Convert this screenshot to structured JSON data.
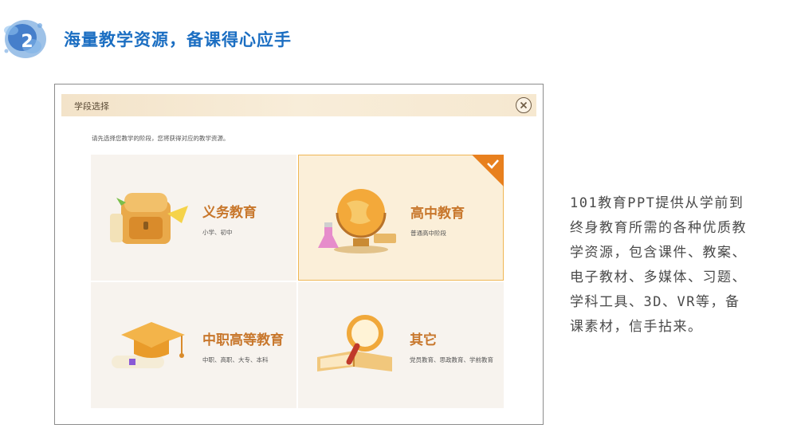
{
  "slide": {
    "number": "2",
    "title": "海量教学资源，备课得心应手"
  },
  "dialog": {
    "title": "学段选择",
    "description": "请先选择您教学的阶段，您将获得对应的教学资源。",
    "cards": [
      {
        "title": "义务教育",
        "subtitle": "小学、初中",
        "selected": false,
        "icon": "schoolbag-icon"
      },
      {
        "title": "高中教育",
        "subtitle": "普通高中阶段",
        "selected": true,
        "icon": "globe-flask-icon"
      },
      {
        "title": "中职高等教育",
        "subtitle": "中职、高职、大专、本科",
        "selected": false,
        "icon": "graduation-cap-icon"
      },
      {
        "title": "其它",
        "subtitle": "党员教育、思政教育、学前教育",
        "selected": false,
        "icon": "magnifier-book-icon"
      }
    ]
  },
  "side_text": "101教育PPT提供从学前到终身教育所需的各种优质教学资源，包含课件、教案、电子教材、多媒体、习题、学科工具、3D、VR等，备课素材，信手拈来。",
  "colors": {
    "title_blue": "#1b6ec2",
    "card_title_orange": "#c8772c",
    "selected_border": "#f0b654",
    "check_orange": "#e8801e"
  }
}
